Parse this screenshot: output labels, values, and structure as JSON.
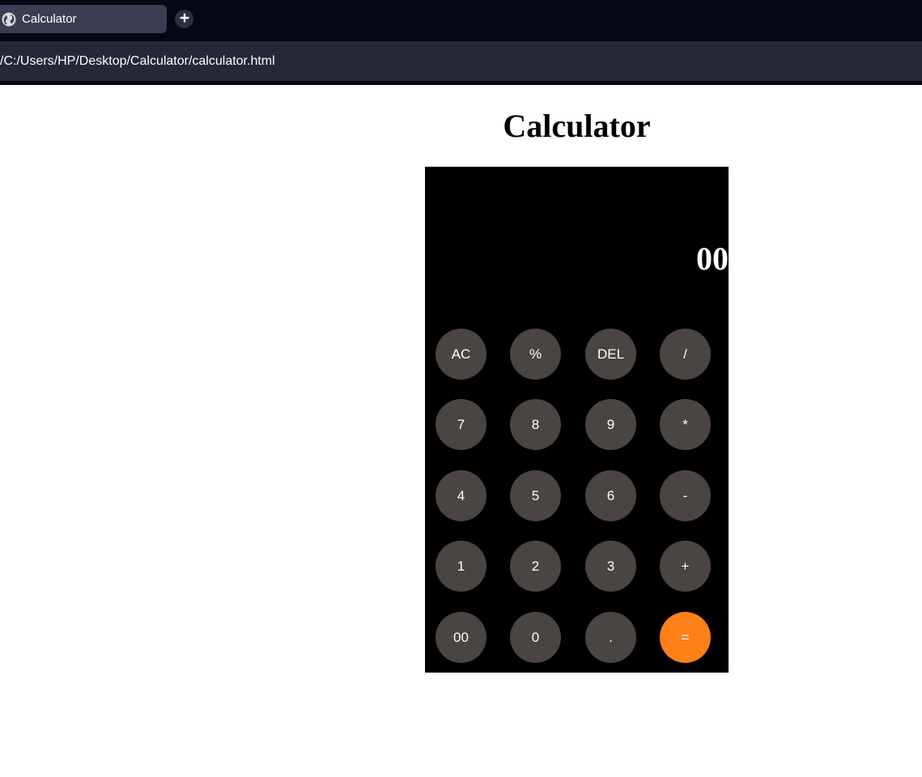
{
  "browser": {
    "tab_title": "Calculator",
    "address": "/C:/Users/HP/Desktop/Calculator/calculator.html"
  },
  "page": {
    "title": "Calculator"
  },
  "calculator": {
    "display": "00",
    "keys": {
      "ac": "AC",
      "percent": "%",
      "del": "DEL",
      "divide": "/",
      "seven": "7",
      "eight": "8",
      "nine": "9",
      "multiply": "*",
      "four": "4",
      "five": "5",
      "six": "6",
      "subtract": "-",
      "one": "1",
      "two": "2",
      "three": "3",
      "add": "+",
      "double_zero": "00",
      "zero": "0",
      "decimal": ".",
      "equals": "="
    },
    "colors": {
      "key": "#4a4443",
      "equals": "#ff7f18",
      "body": "#000000"
    }
  },
  "icons": {
    "tab_icon": "globe-icon",
    "new_tab": "plus-icon"
  }
}
